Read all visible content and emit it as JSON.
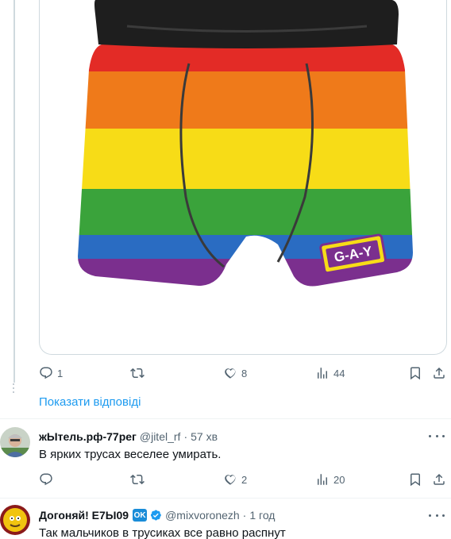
{
  "colors": {
    "accent": "#1d9bf0",
    "muted": "#536471",
    "text": "#0f1419",
    "border": "#cfd9de",
    "flag": [
      "#e32b26",
      "#ef7a1a",
      "#f7dc17",
      "#3aa33b",
      "#2a6cc2",
      "#7b2f8e"
    ]
  },
  "media": {
    "badge_text": "G-A-Y"
  },
  "first_tweet_actions": {
    "reply_count": "1",
    "retweet_count": "",
    "like_count": "8",
    "views_count": "44"
  },
  "show_replies_label": "Показати відповіді",
  "replies": [
    {
      "name": "жЫтель.рф-77рег",
      "handle": "@jitel_rf",
      "time": "57 хв",
      "text": "В ярких трусах веселее умирать.",
      "actions": {
        "reply_count": "",
        "retweet_count": "",
        "like_count": "2",
        "views_count": "20"
      }
    },
    {
      "name": "Догоняй! Е7Ы09",
      "badge": "OK",
      "handle": "@mixvoronezh",
      "time": "1 год",
      "text": "Так мальчиков в трусиках все равно распнут"
    }
  ],
  "icons": [
    "reply-icon",
    "retweet-icon",
    "like-icon",
    "views-icon",
    "bookmark-icon",
    "share-icon",
    "more-icon",
    "verified-icon"
  ]
}
